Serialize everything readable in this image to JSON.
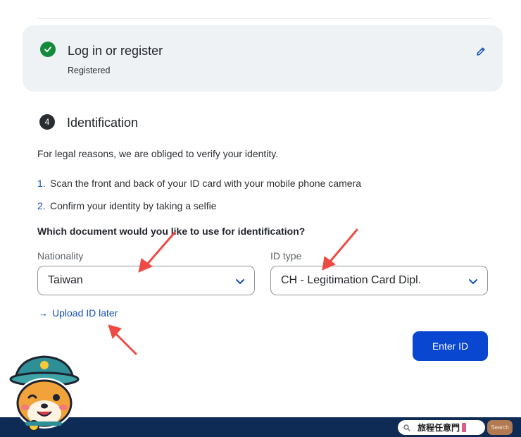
{
  "login_step": {
    "title": "Log in or register",
    "subtitle": "Registered",
    "status_color": "#148a3d"
  },
  "identification": {
    "step_number": "4",
    "title": "Identification",
    "intro": "For legal reasons, we are obliged to verify your identity.",
    "steps": [
      {
        "num": "1.",
        "text": "Scan the front and back of your ID card with your mobile phone camera"
      },
      {
        "num": "2.",
        "text": "Confirm your identity by taking a selfie"
      }
    ],
    "question": "Which document would you like to use for identification?",
    "nationality": {
      "label": "Nationality",
      "value": "Taiwan"
    },
    "id_type": {
      "label": "ID type",
      "value": "CH - Legitimation Card Dipl."
    },
    "upload_later": "Upload ID later",
    "enter_button": "Enter ID"
  },
  "footer": {
    "brand": "旅程任意門",
    "search_label": "Search"
  },
  "colors": {
    "accent": "#0a47d1",
    "link": "#1550b8",
    "annotation_arrow": "#ee4b45",
    "footer_bg": "#0e2b55"
  }
}
